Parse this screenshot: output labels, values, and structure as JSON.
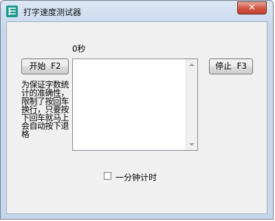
{
  "window": {
    "title": "打字速度测试器",
    "close_glyph": "✕",
    "app_icon": "app-logo-icon"
  },
  "timer": {
    "text": "0秒"
  },
  "buttons": {
    "start_label": "开始 F2",
    "stop_label": "停止 F3"
  },
  "typing_area": {
    "value": ""
  },
  "note": {
    "text": "为保证字数统计的准确性，限制了按回车换行，只要按下回车就马上会自动按下退格"
  },
  "options": {
    "one_minute_label": "一分钟计时",
    "one_minute_checked": false
  },
  "colors": {
    "close_red": "#c24332",
    "app_icon": "#1c9a8a"
  }
}
